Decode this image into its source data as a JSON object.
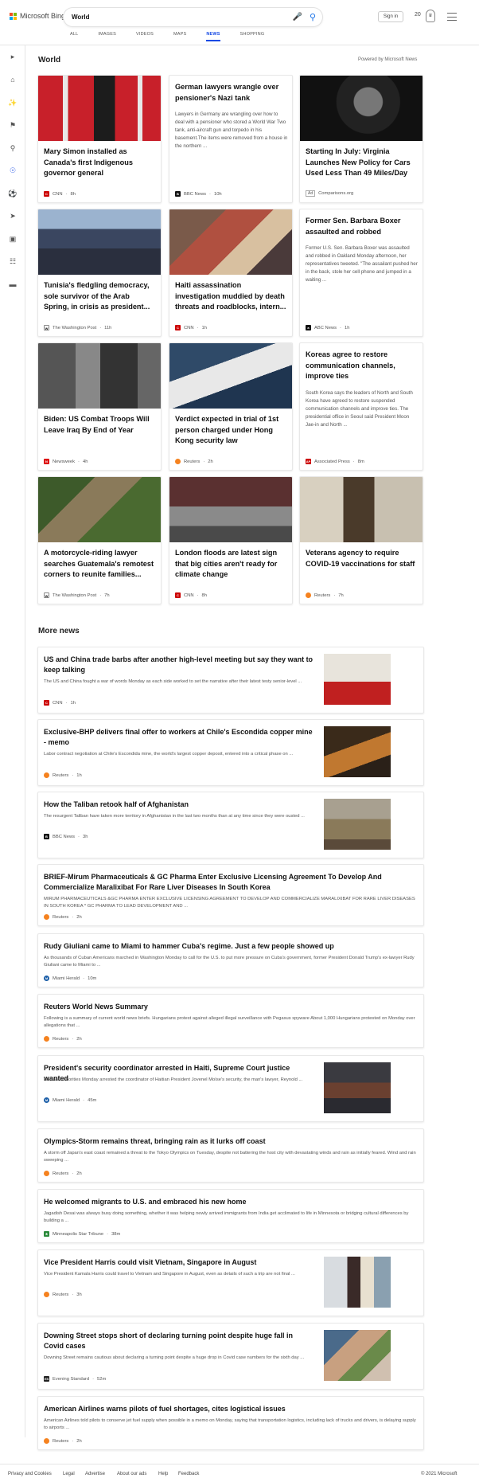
{
  "header": {
    "brand": "Microsoft Bing",
    "query": "World",
    "signin": "Sign in",
    "points": "20"
  },
  "tabs": [
    "ALL",
    "IMAGES",
    "VIDEOS",
    "MAPS",
    "NEWS",
    "SHOPPING"
  ],
  "section": {
    "title": "World",
    "powered": "Powered by Microsoft News"
  },
  "cards": [
    {
      "title": "Mary Simon installed as Canada's first Indigenous governor general",
      "source": "CNN",
      "age": "8h"
    },
    {
      "title": "German lawyers wrangle over pensioner's Nazi tank",
      "desc": "Lawyers in Germany are wrangling over how to deal with a pensioner who stored a World War Two tank, anti-aircraft gun and torpedo in his basement.The items were removed from a house in the northern ...",
      "source": "BBC News",
      "age": "10h"
    },
    {
      "title": "Starting In July: Virginia Launches New Policy for Cars Used Less Than 49 Miles/Day",
      "source": "Comparisons.org",
      "age": "Ad"
    },
    {
      "title": "Tunisia's fledgling democracy, sole survivor of the Arab Spring, in crisis as president...",
      "source": "The Washington Post",
      "age": "11h"
    },
    {
      "title": "Haiti assassination investigation muddied by death threats and roadblocks, intern...",
      "source": "CNN",
      "age": "1h"
    },
    {
      "title": "Former Sen. Barbara Boxer assaulted and robbed",
      "desc": "Former U.S. Sen. Barbara Boxer was assaulted and robbed in Oakland Monday afternoon, her representatives tweeted. \"The assailant pushed her in the back, stole her cell phone and jumped in a waiting ...",
      "source": "ABC News",
      "age": "1h"
    },
    {
      "title": "Biden: US Combat Troops Will Leave Iraq By End of Year",
      "source": "Newsweek",
      "age": "4h"
    },
    {
      "title": "Verdict expected in trial of 1st person charged under Hong Kong security law",
      "source": "Reuters",
      "age": "2h"
    },
    {
      "title": "Koreas agree to restore communication channels, improve ties",
      "desc": "South Korea says the leaders of North and South Korea have agreed to restore suspended communication channels and improve ties. The presidential office in Seoul said President Moon Jae-in and North ...",
      "source": "Associated Press",
      "age": "8m"
    },
    {
      "title": "A motorcycle-riding lawyer searches Guatemala's remotest corners to reunite families...",
      "source": "The Washington Post",
      "age": "7h"
    },
    {
      "title": "London floods are latest sign that big cities aren't ready for climate change",
      "source": "CNN",
      "age": "8h"
    },
    {
      "title": "Veterans agency to require COVID-19 vaccinations for staff",
      "source": "Reuters",
      "age": "7h"
    }
  ],
  "more_title": "More news",
  "more": [
    {
      "title": "US and China trade barbs after another high-level meeting but say they want to keep talking",
      "desc": "The US and China fought a war of words Monday as each side worked to set the narrative after their latest testy senior-level ...",
      "source": "CNN",
      "age": "1h"
    },
    {
      "title": "Exclusive-BHP delivers final offer to workers at Chile's Escondida copper mine - memo",
      "desc": "Labor contract negotiation at Chile's Escondida mine, the world's largest copper deposit, entered into a critical phase on ...",
      "source": "Reuters",
      "age": "1h"
    },
    {
      "title": "How the Taliban retook half of Afghanistan",
      "desc": "The resurgent Taliban have taken more territory in Afghanistan in the last two months than at any time since they were ousted ...",
      "source": "BBC News",
      "age": "3h"
    },
    {
      "title": "BRIEF-Mirum Pharmaceuticals & GC Pharma Enter Exclusive Licensing Agreement To Develop And Commercialize Maralixibat For Rare Liver Diseases In South Korea",
      "desc": "MIRUM PHARMACEUTICALS &GC PHARMA ENTER EXCLUSIVE LICENSING AGREEMENT TO DEVELOP AND COMMERCIALIZE MARALIXIBAT FOR RARE LIVER DISEASES IN SOUTH KOREA * GC PHARMA TO LEAD DEVELOPMENT AND ...",
      "source": "Reuters",
      "age": "2h"
    },
    {
      "title": "Rudy Giuliani came to Miami to hammer Cuba's regime. Just a few people showed up",
      "desc": "As thousands of Cuban Americans marched in Washington Monday to call for the U.S. to put more pressure on Cuba's government, former President Donald Trump's ex-lawyer Rudy Giuliani came to Miami to ...",
      "source": "Miami Herald",
      "age": "10m"
    },
    {
      "title": "Reuters World News Summary",
      "desc": "Following is a summary of current world news briefs. Hungarians protest against alleged illegal surveillance with Pegasus spyware About 1,000 Hungarians protested on Monday over allegations that ...",
      "source": "Reuters",
      "age": "2h"
    },
    {
      "title": "President's security coordinator arrested in Haiti, Supreme Court justice wanted",
      "desc": "Haitian authorities Monday arrested the coordinator of Haitian President Jovenel Moïse's security, the man's lawyer, Reynold ...",
      "source": "Miami Herald",
      "age": "45m"
    },
    {
      "title": "Olympics-Storm remains threat, bringing rain as it lurks off coast",
      "desc": "A storm off Japan's east coast remained a threat to the Tokyo Olympics on Tuesday, despite not battering the host city with devastating winds and rain as initially feared. Wind and rain sweeping ...",
      "source": "Reuters",
      "age": "2h"
    },
    {
      "title": "He welcomed migrants to U.S. and embraced his new home",
      "desc": "Jagadish Desai was always busy doing something, whether it was helping newly arrived immigrants from India get acclimated to life in Minnesota or bridging cultural differences by building a ...",
      "source": "Minneapolis Star Tribune",
      "age": "38m"
    },
    {
      "title": "Vice President Harris could visit Vietnam, Singapore in August",
      "desc": "Vice President Kamala Harris could travel to Vietnam and Singapore in August, even as details of such a trip are not final ...",
      "source": "Reuters",
      "age": "3h"
    },
    {
      "title": "Downing Street stops short of declaring turning point despite huge fall in Covid cases",
      "desc": "Downing Street remains cautious about declaring a turning point despite a huge drop in Covid case numbers for the sixth day ...",
      "source": "Evening Standard",
      "age": "52m"
    },
    {
      "title": "American Airlines warns pilots of fuel shortages, cites logistical issues",
      "desc": "American Airlines told pilots to conserve jet fuel supply when possible in a memo on Monday, saying that transportation logistics, including lack of trucks and drivers, is delaying supply to airports ...",
      "source": "Reuters",
      "age": "2h"
    }
  ],
  "footer": [
    "Privacy and Cookies",
    "Legal",
    "Advertise",
    "About our ads",
    "Help",
    "Feedback"
  ],
  "copyright": "© 2021 Microsoft"
}
